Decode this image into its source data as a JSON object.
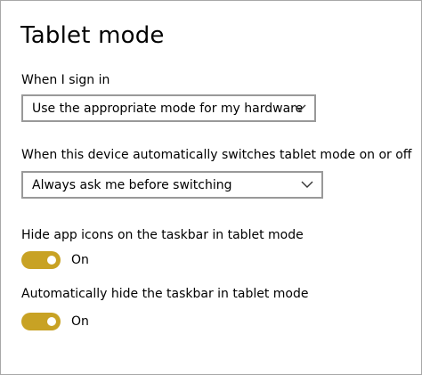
{
  "page": {
    "title": "Tablet mode"
  },
  "sign_in": {
    "label": "When I sign in",
    "selected": "Use the appropriate mode for my hardware"
  },
  "auto_switch": {
    "label": "When this device automatically switches tablet mode on or off",
    "selected": "Always ask me before switching"
  },
  "hide_icons": {
    "label": "Hide app icons on the taskbar in tablet mode",
    "state": "On",
    "on": true
  },
  "hide_taskbar": {
    "label": "Automatically hide the taskbar in tablet mode",
    "state": "On",
    "on": true
  },
  "colors": {
    "toggle_on": "#c8a224",
    "dropdown_border": "#999999",
    "frame_border": "#a8a8a8"
  },
  "icons": {
    "dropdown_arrow": "chevron-down-icon",
    "toggle_knob": "toggle-knob-icon"
  }
}
